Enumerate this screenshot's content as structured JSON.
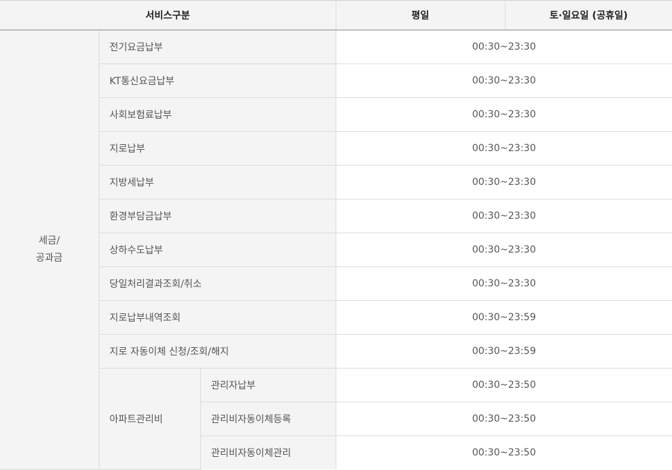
{
  "header": {
    "service": "서비스구분",
    "weekday": "평일",
    "weekend": "토·일요일 (공휴일)"
  },
  "category": {
    "line1": "세금/",
    "line2": "공과금"
  },
  "rows": [
    {
      "label": "전기요금납부",
      "hours": "00:30~23:30"
    },
    {
      "label": "KT통신요금납부",
      "hours": "00:30~23:30"
    },
    {
      "label": "사회보험료납부",
      "hours": "00:30~23:30"
    },
    {
      "label": "지로납부",
      "hours": "00:30~23:30"
    },
    {
      "label": "지방세납부",
      "hours": "00:30~23:30"
    },
    {
      "label": "환경부담금납부",
      "hours": "00:30~23:30"
    },
    {
      "label": "상하수도납부",
      "hours": "00:30~23:30"
    },
    {
      "label": "당일처리결과조회/취소",
      "hours": "00:30~23:30"
    },
    {
      "label": "지로납부내역조회",
      "hours": "00:30~23:59"
    },
    {
      "label": "지로 자동이체 신청/조회/해지",
      "hours": "00:30~23:59"
    }
  ],
  "apartment": {
    "label": "아파트관리비",
    "rows": [
      {
        "label": "관리자납부",
        "hours": "00:30~23:50"
      },
      {
        "label": "관리비자동이체등록",
        "hours": "00:30~23:50"
      },
      {
        "label": "관리비자동이체관리",
        "hours": "00:30~23:50"
      }
    ]
  }
}
